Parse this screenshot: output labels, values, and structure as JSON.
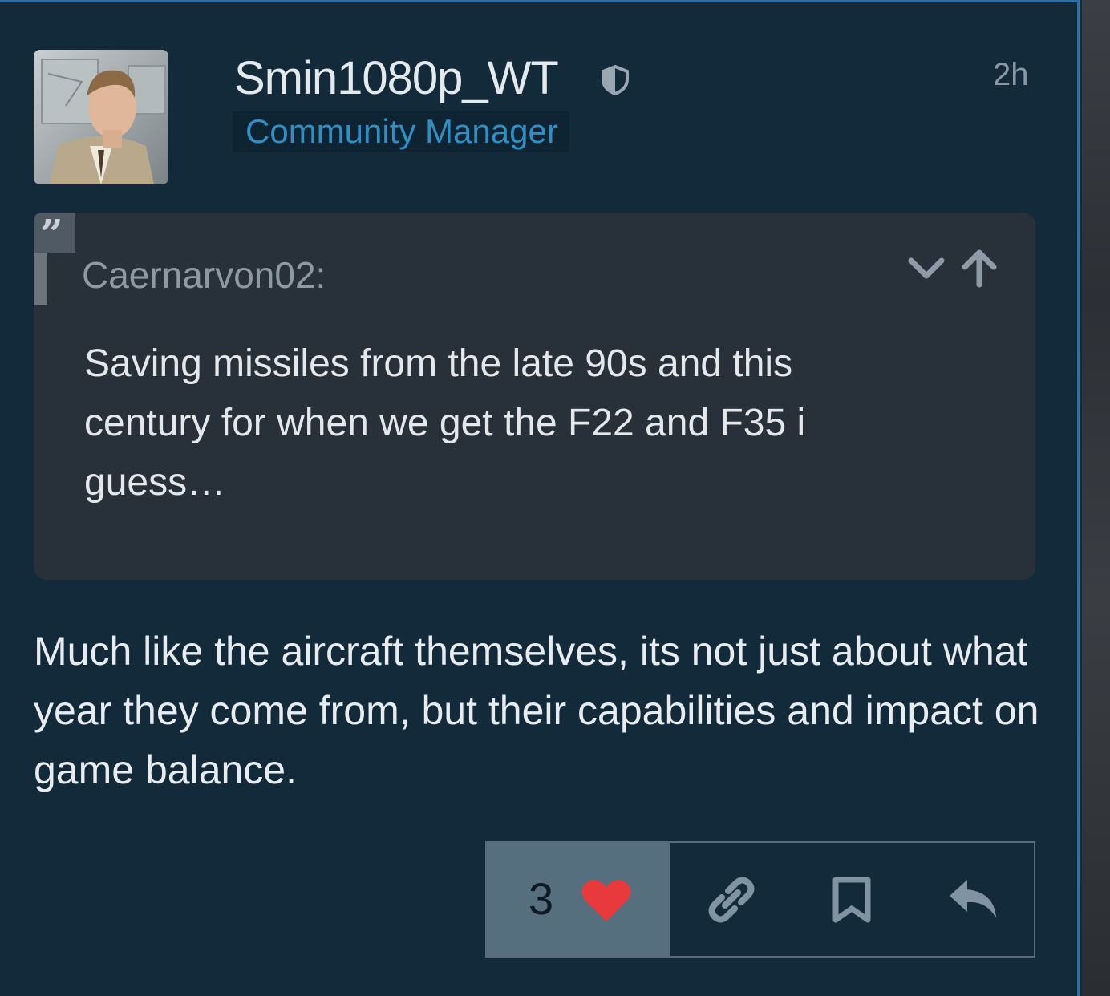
{
  "post": {
    "username": "Smin1080p_WT",
    "user_title": "Community Manager",
    "timestamp": "2h",
    "quote": {
      "author": "Caernarvon02:",
      "text": "Saving missiles from the late 90s and this century for when we get the F22 and F35 i guess…"
    },
    "body": "Much like the aircraft themselves, its not just about what year they come from, but their capabilities and impact on game balance.",
    "actions": {
      "like_count": "3"
    }
  },
  "icons": {
    "moderator": "shield-icon",
    "quote": "quote-icon",
    "expand": "chevron-down-icon",
    "goto": "arrow-up-icon",
    "like": "heart-icon",
    "link": "link-icon",
    "bookmark": "bookmark-icon",
    "reply": "reply-icon"
  },
  "colors": {
    "background": "#122a3a",
    "quote_background": "#283039",
    "title_accent": "#2f8fc4",
    "like_button": "#566f7e",
    "heart": "#e8393c"
  }
}
